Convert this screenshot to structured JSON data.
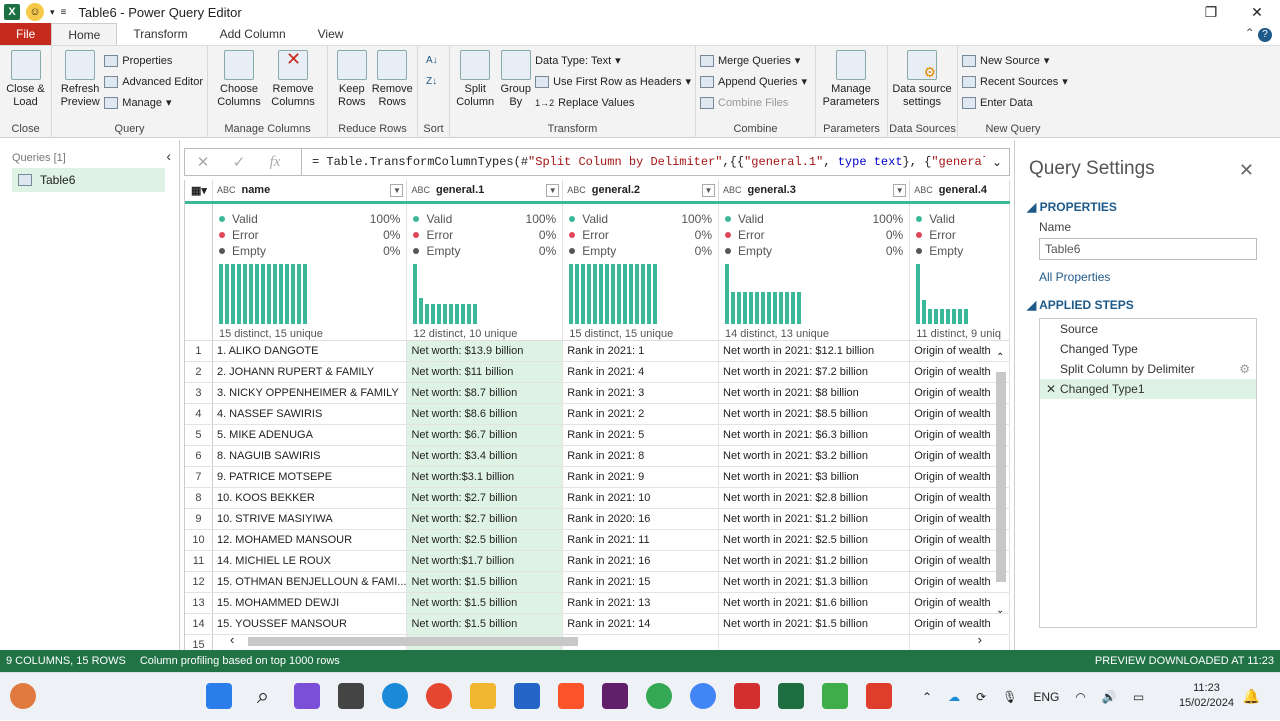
{
  "window": {
    "title": "Table6 - Power Query Editor"
  },
  "tabs": [
    "File",
    "Home",
    "Transform",
    "Add Column",
    "View"
  ],
  "ribbon": {
    "close_load": "Close & Load",
    "close_group": "Close",
    "refresh_preview": "Refresh Preview",
    "properties": "Properties",
    "advanced_editor": "Advanced Editor",
    "manage": "Manage",
    "query_group": "Query",
    "choose_columns": "Choose Columns",
    "remove_columns": "Remove Columns",
    "manage_columns_group": "Manage Columns",
    "keep_rows": "Keep Rows",
    "remove_rows": "Remove Rows",
    "reduce_rows_group": "Reduce Rows",
    "sort_group": "Sort",
    "split_column": "Split Column",
    "group_by": "Group By",
    "data_type": "Data Type: Text",
    "use_first_row": "Use First Row as Headers",
    "replace_values": "Replace Values",
    "transform_group": "Transform",
    "merge_queries": "Merge Queries",
    "append_queries": "Append Queries",
    "combine_files": "Combine Files",
    "combine_group": "Combine",
    "manage_parameters": "Manage Parameters",
    "parameters_group": "Parameters",
    "data_source_settings": "Data source settings",
    "data_sources_group": "Data Sources",
    "new_source": "New Source",
    "recent_sources": "Recent Sources",
    "enter_data": "Enter Data",
    "new_query_group": "New Query"
  },
  "formula": {
    "prefix": "= Table.TransformColumnTypes(#",
    "s1": "\"Split Column by Delimiter\"",
    "mid1": ",{{",
    "s2": "\"general.1\"",
    "mid2": ", ",
    "k1": "type text",
    "mid3": "}, {",
    "s3": "\"general.2\"",
    "tail": ","
  },
  "queries": {
    "header": "Queries [1]",
    "item": "Table6"
  },
  "profile_labels": {
    "valid": "Valid",
    "error": "Error",
    "empty": "Empty"
  },
  "columns": [
    {
      "name": "name",
      "valid": "100%",
      "error": "0%",
      "empty": "0%",
      "distinct": "15 distinct, 15 unique"
    },
    {
      "name": "general.1",
      "valid": "100%",
      "error": "0%",
      "empty": "0%",
      "distinct": "12 distinct, 10 unique"
    },
    {
      "name": "general.2",
      "valid": "100%",
      "error": "0%",
      "empty": "0%",
      "distinct": "15 distinct, 15 unique"
    },
    {
      "name": "general.3",
      "valid": "100%",
      "error": "0%",
      "empty": "0%",
      "distinct": "14 distinct, 13 unique"
    },
    {
      "name": "general.4",
      "valid": "",
      "error": "",
      "empty": "",
      "distinct": "11 distinct, 9 uniq"
    }
  ],
  "histograms": [
    [
      1,
      1,
      1,
      1,
      1,
      1,
      1,
      1,
      1,
      1,
      1,
      1,
      1,
      1,
      1
    ],
    [
      1,
      0.42,
      0.32,
      0.32,
      0.32,
      0.32,
      0.32,
      0.32,
      0.32,
      0.32,
      0.32
    ],
    [
      1,
      1,
      1,
      1,
      1,
      1,
      1,
      1,
      1,
      1,
      1,
      1,
      1,
      1,
      1
    ],
    [
      1,
      0.52,
      0.52,
      0.52,
      0.52,
      0.52,
      0.52,
      0.52,
      0.52,
      0.52,
      0.52,
      0.52,
      0.52
    ],
    [
      1,
      0.4,
      0.25,
      0.25,
      0.25,
      0.25,
      0.25,
      0.25,
      0.25
    ]
  ],
  "rows": [
    [
      "1",
      "1. ALIKO DANGOTE",
      "Net worth: $13.9 billion",
      "Rank in 2021: 1",
      "Net worth in 2021: $12.1 billion",
      "Origin of wealth"
    ],
    [
      "2",
      "2. JOHANN RUPERT & FAMILY",
      "Net worth: $11 billion",
      "Rank in 2021: 4",
      "Net worth in 2021: $7.2 billion",
      "Origin of wealth"
    ],
    [
      "3",
      "3. NICKY OPPENHEIMER & FAMILY",
      "Net worth: $8.7 billion",
      "Rank in 2021: 3",
      "Net worth in 2021: $8 billion",
      "Origin of wealth"
    ],
    [
      "4",
      "4. NASSEF SAWIRIS",
      "Net worth: $8.6 billion",
      "Rank in 2021: 2",
      "Net worth in 2021: $8.5 billion",
      "Origin of wealth"
    ],
    [
      "5",
      "5. MIKE ADENUGA",
      "Net worth: $6.7 billion",
      "Rank in 2021: 5",
      "Net worth in 2021: $6.3 billion",
      "Origin of wealth"
    ],
    [
      "6",
      "8. NAGUIB SAWIRIS",
      "Net worth: $3.4 billion",
      "Rank in 2021: 8",
      "Net worth in 2021: $3.2 billion",
      "Origin of wealth"
    ],
    [
      "7",
      "9. PATRICE MOTSEPE",
      "Net worth:$3.1 billion",
      "Rank in 2021: 9",
      "Net worth in 2021: $3 billion",
      "Origin of wealth"
    ],
    [
      "8",
      "10. KOOS BEKKER",
      "Net worth: $2.7 billion",
      "Rank in 2021: 10",
      "Net worth in 2021: $2.8 billion",
      "Origin of wealth"
    ],
    [
      "9",
      "10. STRIVE MASIYIWA",
      "Net worth: $2.7 billion",
      "Rank in 2020: 16",
      "Net worth in 2021: $1.2 billion",
      "Origin of wealth"
    ],
    [
      "10",
      "12. MOHAMED MANSOUR",
      "Net worth: $2.5 billion",
      "Rank in 2021: 11",
      "Net worth in 2021: $2.5 billion",
      "Origin of wealth"
    ],
    [
      "11",
      "14. MICHIEL LE ROUX",
      "Net worth:$1.7 billion",
      "Rank in 2021: 16",
      "Net worth in 2021: $1.2 billion",
      "Origin of wealth"
    ],
    [
      "12",
      "15. OTHMAN BENJELLOUN & FAMI...",
      "Net worth: $1.5 billion",
      "Rank in 2021: 15",
      "Net worth in 2021: $1.3 billion",
      "Origin of wealth"
    ],
    [
      "13",
      "15. MOHAMMED DEWJI",
      "Net worth: $1.5 billion",
      "Rank in 2021: 13",
      "Net worth in 2021: $1.6 billion",
      "Origin of wealth"
    ],
    [
      "14",
      "15. YOUSSEF MANSOUR",
      "Net worth: $1.5 billion",
      "Rank in 2021: 14",
      "Net worth in 2021: $1.5 billion",
      "Origin of wealth"
    ],
    [
      "15",
      "",
      "",
      "",
      "",
      ""
    ]
  ],
  "settings": {
    "title": "Query Settings",
    "properties": "PROPERTIES",
    "name_label": "Name",
    "name_value": "Table6",
    "all_properties": "All Properties",
    "applied_steps": "APPLIED STEPS",
    "steps": [
      "Source",
      "Changed Type",
      "Split Column by Delimiter",
      "Changed Type1"
    ]
  },
  "status": {
    "columns_rows": "9 COLUMNS, 15 ROWS",
    "profiling": "Column profiling based on top 1000 rows",
    "preview": "PREVIEW DOWNLOADED AT 11:23"
  },
  "taskbar": {
    "time": "11:23",
    "date": "15/02/2024",
    "lang": "ENG"
  },
  "colors": {
    "accent": "#217346",
    "profile_bar": "#3bb89a",
    "selected": "#dff3e5",
    "file_tab": "#c42b1c"
  }
}
